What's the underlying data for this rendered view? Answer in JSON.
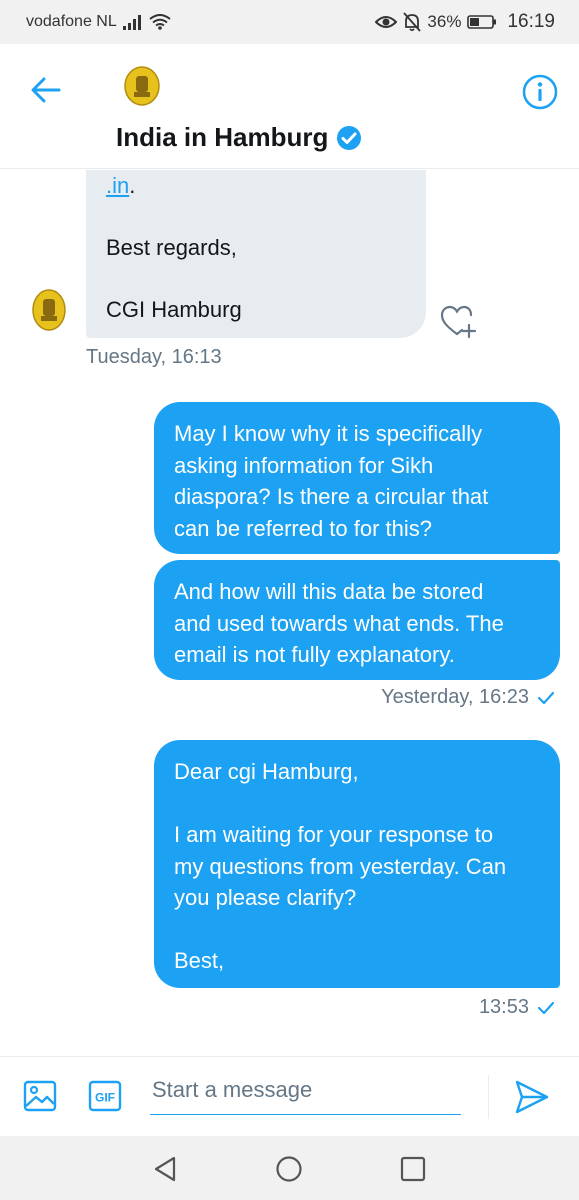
{
  "status_bar": {
    "carrier": "vodafone NL",
    "battery": "36%",
    "time": "16:19"
  },
  "header": {
    "title": "India in Hamburg"
  },
  "conversation": {
    "incoming": {
      "lines": [
        ".in.",
        "Best regards,",
        "CGI Hamburg"
      ],
      "timestamp": "Tuesday, 16:13"
    },
    "outgoing": [
      {
        "lines": [
          "May I know why it is specifically",
          "asking information for Sikh",
          "diaspora? Is there a circular that",
          "can be referred to for this?"
        ]
      },
      {
        "lines": [
          "And how will this data be stored",
          "and used towards what ends. The",
          "email is not fully explanatory."
        ],
        "timestamp": "Yesterday, 16:23"
      },
      {
        "lines": [
          "Dear cgi Hamburg,",
          "I am waiting for your response to",
          "my questions from yesterday. Can",
          "you please clarify?",
          "Best,"
        ],
        "timestamp": "13:53"
      }
    ]
  },
  "composer": {
    "placeholder": "Start a message",
    "gif_label": "GIF"
  },
  "colors": {
    "accent": "#1da1f2",
    "incoming_bubble": "#e6ecf0",
    "muted_text": "#657786"
  }
}
